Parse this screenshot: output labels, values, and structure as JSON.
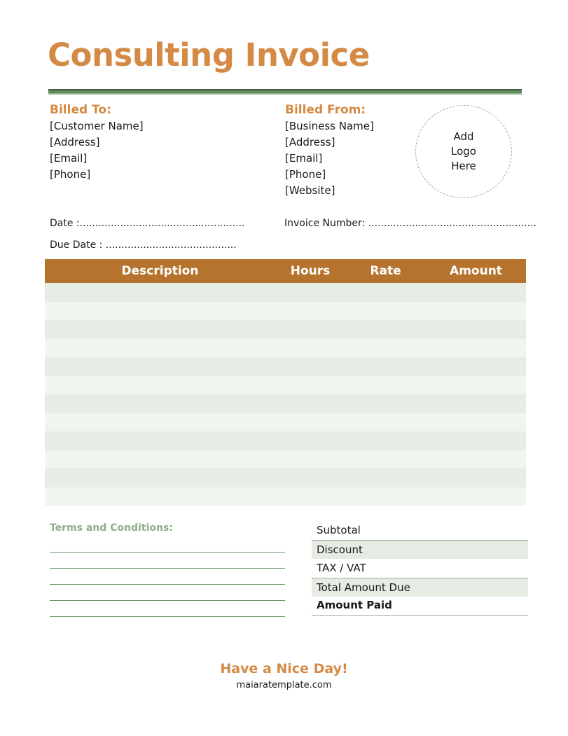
{
  "title": "Consulting Invoice",
  "billed_to": {
    "heading": "Billed To:",
    "lines": [
      "[Customer Name]",
      "[Address]",
      "[Email]",
      "[Phone]"
    ]
  },
  "billed_from": {
    "heading": "Billed From:",
    "lines": [
      "[Business Name]",
      "[Address]",
      "[Email]",
      "[Phone]",
      "[Website]"
    ]
  },
  "logo_placeholder": [
    "Add",
    "Logo",
    "Here"
  ],
  "fields": {
    "date": "Date :.....................................................",
    "due_date": "Due Date : ..........................................",
    "invoice_number": "Invoice Number: ......................................................"
  },
  "table": {
    "headers": [
      "Description",
      "Hours",
      "Rate",
      "Amount"
    ],
    "row_count": 12
  },
  "terms": {
    "heading": "Terms and Conditions:",
    "line_count": 5
  },
  "totals": [
    "Subtotal",
    "Discount",
    "TAX / VAT",
    "Total Amount Due",
    "Amount Paid"
  ],
  "footer": {
    "message": "Have a Nice Day!",
    "website": "maiaratemplate.com"
  },
  "colors": {
    "accent_orange": "#d48a45",
    "header_brown": "#b5732d",
    "green_rule": "#5f8a5c",
    "row_shade": "#e6ede5"
  }
}
